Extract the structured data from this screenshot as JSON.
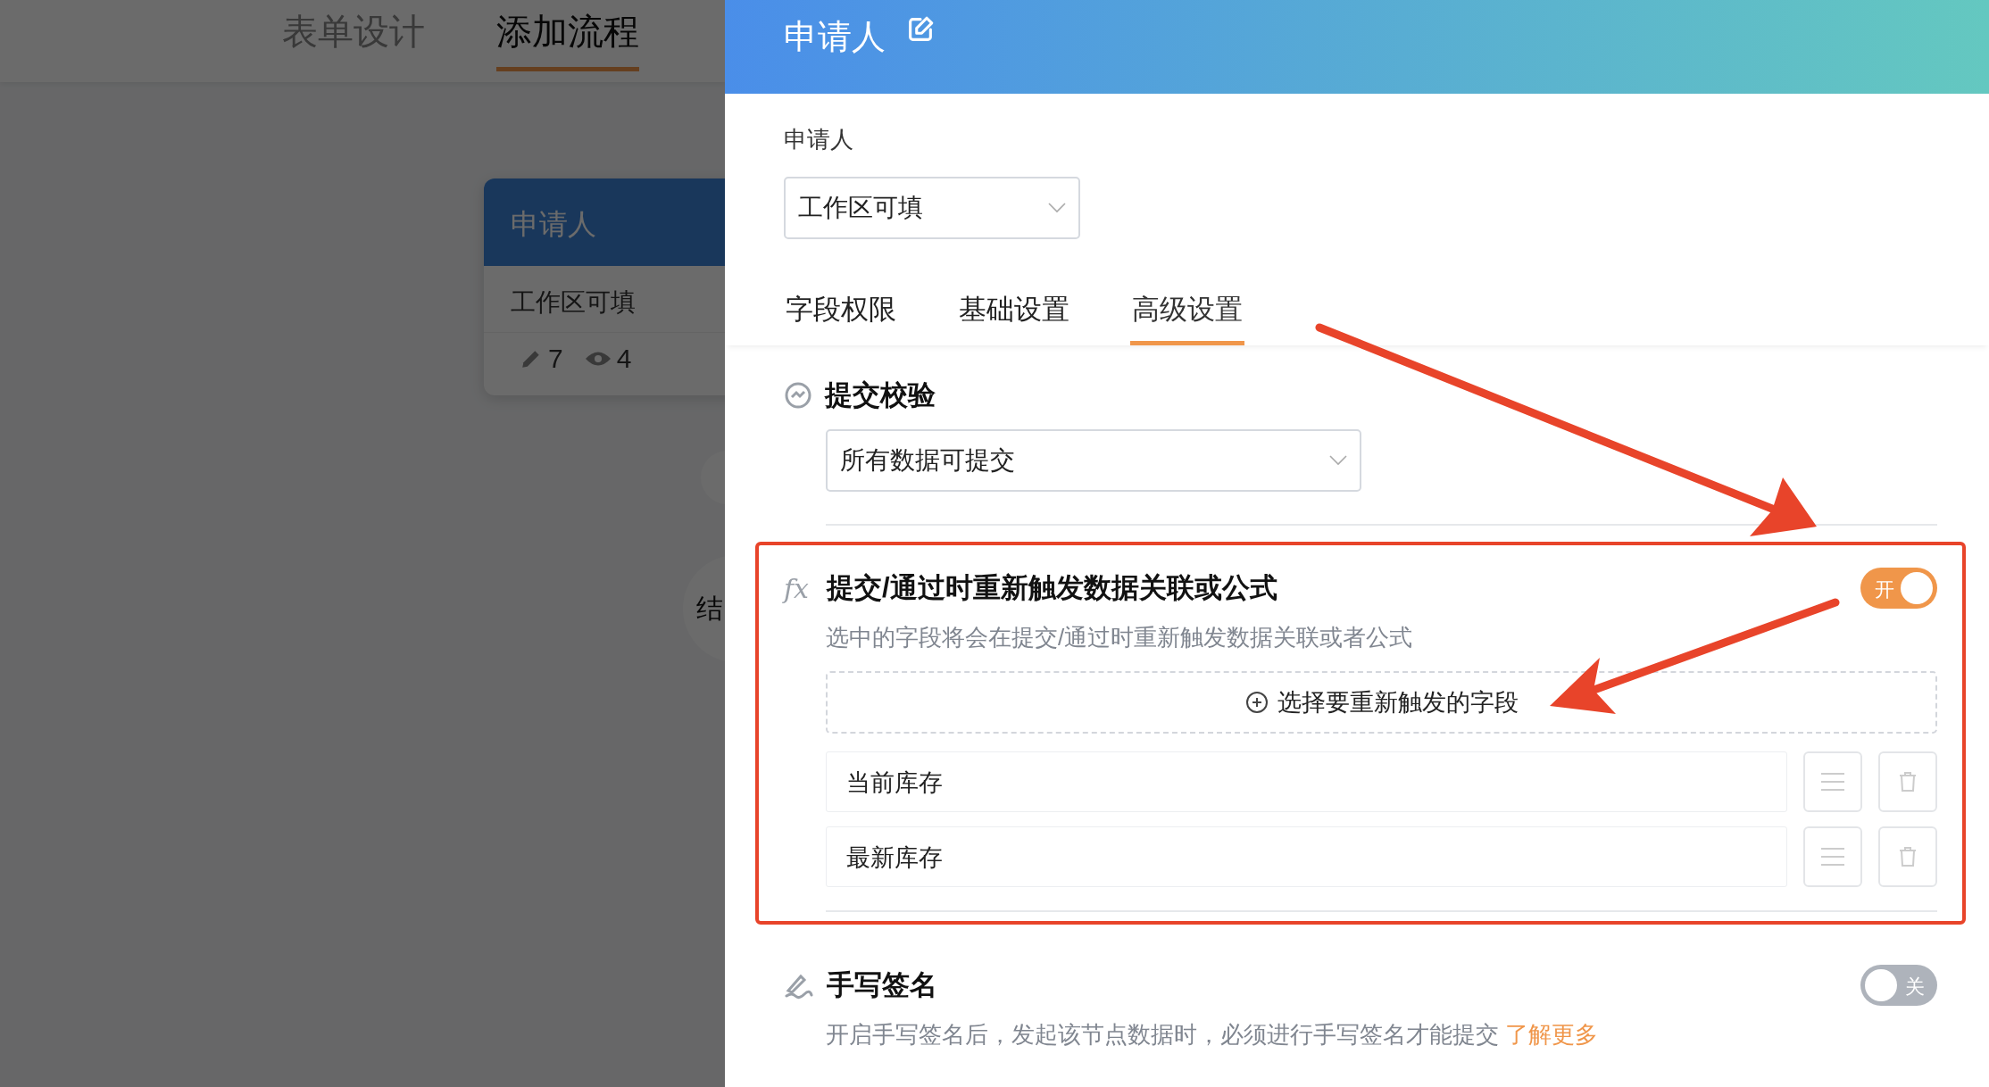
{
  "background_page": {
    "tabs": [
      {
        "label": "表单设计",
        "selected": false
      },
      {
        "label": "添加流程",
        "selected": true
      }
    ],
    "flow_node": {
      "title": "申请人",
      "permission": "工作区可填",
      "edit_count": "7",
      "view_count": "4"
    },
    "end_node": "结"
  },
  "panel": {
    "title": "申请人",
    "field_label": "申请人",
    "permission_select": "工作区可填",
    "tabs": [
      {
        "label": "字段权限",
        "selected": false
      },
      {
        "label": "基础设置",
        "selected": false
      },
      {
        "label": "高级设置",
        "selected": true
      }
    ],
    "sections": [
      {
        "kind": "select",
        "title": "提交校验",
        "value": "所有数据可提交",
        "highlighted": false
      },
      {
        "kind": "fields",
        "icon_text": "fx",
        "title": "提交/通过时重新触发数据关联或公式",
        "on": true,
        "toggle_label": "开",
        "description": "选中的字段将会在提交/通过时重新触发数据关联或者公式",
        "add_label": "选择要重新触发的字段",
        "fields": [
          "当前库存",
          "最新库存"
        ],
        "highlighted": true
      },
      {
        "kind": "toggle",
        "title": "手写签名",
        "on": false,
        "toggle_label": "关",
        "description": "开启手写签名后，发起该节点数据时，必须进行手写签名才能提交",
        "link": "了解更多",
        "highlighted": false
      }
    ]
  }
}
